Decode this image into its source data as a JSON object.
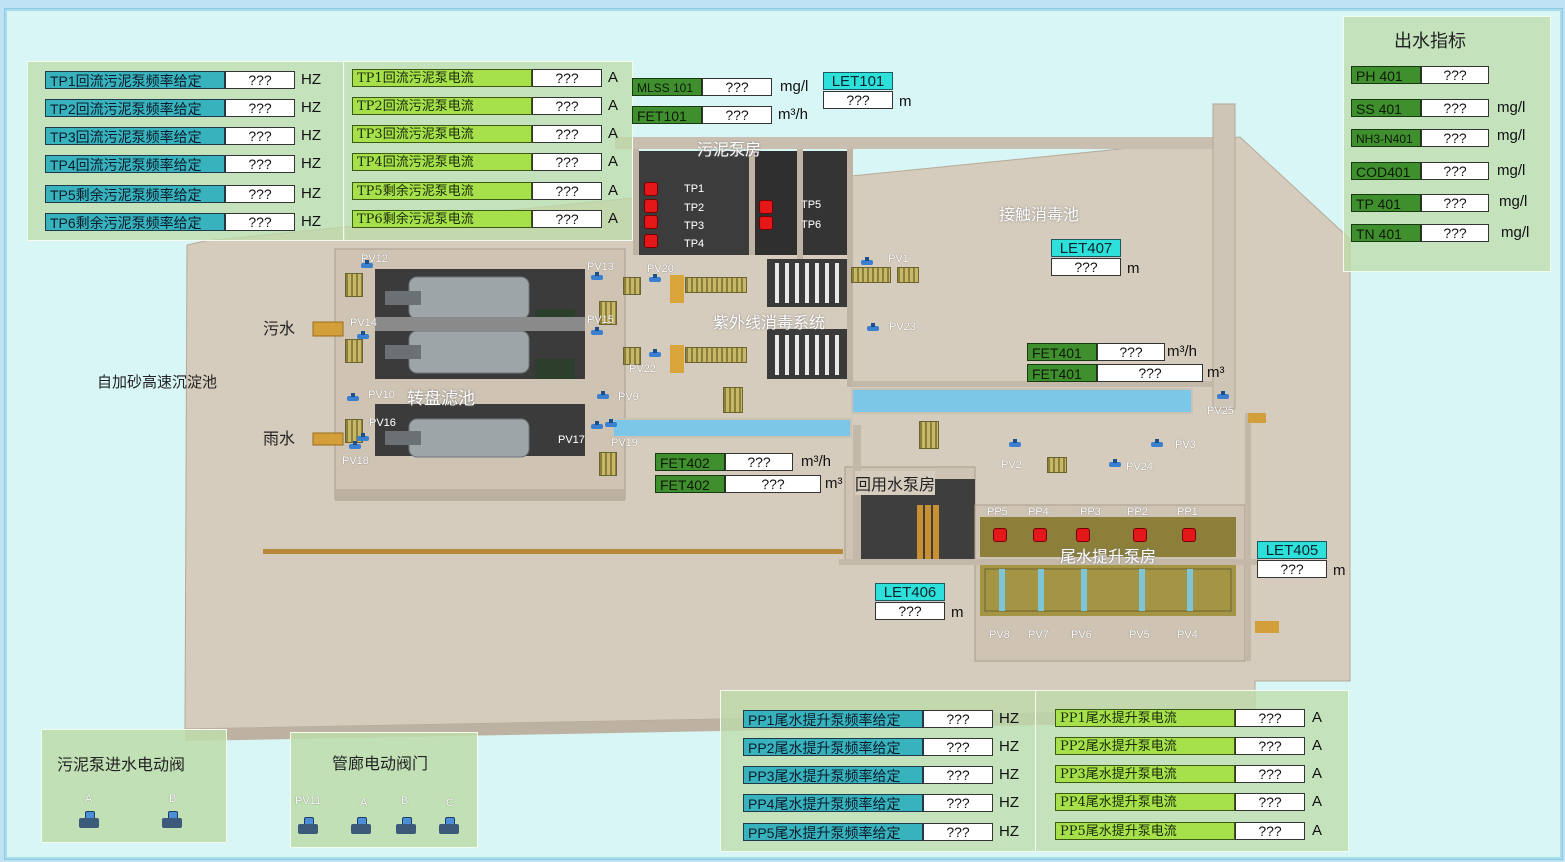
{
  "placeholder": "???",
  "areas": {
    "sedimentation": "自加砂高速沉淀池",
    "sewage": "污水",
    "rain": "雨水",
    "disc_filter": "转盘滤池",
    "sludge_pump_house": "污泥泵房",
    "uv_system": "紫外线消毒系统",
    "contact_pool": "接触消毒池",
    "reuse_pump_house": "回用水泵房",
    "tail_lift_pump_house": "尾水提升泵房"
  },
  "tp_freq_panel": {
    "unit": "HZ",
    "rows": [
      {
        "label": "TP1回流污泥泵频率给定",
        "value": "???"
      },
      {
        "label": "TP2回流污泥泵频率给定",
        "value": "???"
      },
      {
        "label": "TP3回流污泥泵频率给定",
        "value": "???"
      },
      {
        "label": "TP4回流污泥泵频率给定",
        "value": "???"
      },
      {
        "label": "TP5剩余污泥泵频率给定",
        "value": "???"
      },
      {
        "label": "TP6剩余污泥泵频率给定",
        "value": "???"
      }
    ]
  },
  "tp_current_panel": {
    "unit": "A",
    "rows": [
      {
        "label": "TP1回流污泥泵电流",
        "value": "???"
      },
      {
        "label": "TP2回流污泥泵电流",
        "value": "???"
      },
      {
        "label": "TP3回流污泥泵电流",
        "value": "???"
      },
      {
        "label": "TP4回流污泥泵电流",
        "value": "???"
      },
      {
        "label": "TP5剩余污泥泵电流",
        "value": "???"
      },
      {
        "label": "TP6剩余污泥泵电流",
        "value": "???"
      }
    ]
  },
  "instruments": {
    "mlss101": {
      "label": "MLSS 101",
      "value": "???",
      "unit": "mg/l"
    },
    "fet101": {
      "label": "FET101",
      "value": "???",
      "unit": "m³/h"
    },
    "let101": {
      "label": "LET101",
      "value": "???",
      "unit": "m"
    },
    "let407": {
      "label": "LET407",
      "value": "???",
      "unit": "m"
    },
    "fet401_flow": {
      "label": "FET401",
      "value": "???",
      "unit": "m³/h"
    },
    "fet401_total": {
      "label": "FET401",
      "value": "???",
      "unit": "m³"
    },
    "fet402_flow": {
      "label": "FET402",
      "value": "???",
      "unit": "m³/h"
    },
    "fet402_total": {
      "label": "FET402",
      "value": "???",
      "unit": "m³"
    },
    "let405": {
      "label": "LET405",
      "value": "???",
      "unit": "m"
    },
    "let406": {
      "label": "LET406",
      "value": "???",
      "unit": "m"
    }
  },
  "effluent_panel": {
    "title": "出水指标",
    "rows": [
      {
        "label": "PH 401",
        "value": "???",
        "unit": ""
      },
      {
        "label": "SS 401",
        "value": "???",
        "unit": "mg/l"
      },
      {
        "label": "NH3-N401",
        "value": "???",
        "unit": "mg/l"
      },
      {
        "label": "COD401",
        "value": "???",
        "unit": "mg/l"
      },
      {
        "label": "TP 401",
        "value": "???",
        "unit": "mg/l"
      },
      {
        "label": "TN 401",
        "value": "???",
        "unit": "mg/l"
      }
    ]
  },
  "pp_freq_panel": {
    "unit": "HZ",
    "rows": [
      {
        "label": "PP1尾水提升泵频率给定",
        "value": "???"
      },
      {
        "label": "PP2尾水提升泵频率给定",
        "value": "???"
      },
      {
        "label": "PP3尾水提升泵频率给定",
        "value": "???"
      },
      {
        "label": "PP4尾水提升泵频率给定",
        "value": "???"
      },
      {
        "label": "PP5尾水提升泵频率给定",
        "value": "???"
      }
    ]
  },
  "pp_current_panel": {
    "unit": "A",
    "rows": [
      {
        "label": "PP1尾水提升泵电流",
        "value": "???"
      },
      {
        "label": "PP2尾水提升泵电流",
        "value": "???"
      },
      {
        "label": "PP3尾水提升泵电流",
        "value": "???"
      },
      {
        "label": "PP4尾水提升泵电流",
        "value": "???"
      },
      {
        "label": "PP5尾水提升泵电流",
        "value": "???"
      }
    ]
  },
  "sludge_valves_panel": {
    "title": "污泥泵进水电动阀",
    "valves": [
      "A",
      "B"
    ]
  },
  "gallery_valves_panel": {
    "title": "管廊电动阀门",
    "valves": [
      "PV11",
      "A",
      "B",
      "C"
    ]
  },
  "tags": {
    "tp1": "TP1",
    "tp2": "TP2",
    "tp3": "TP3",
    "tp4": "TP4",
    "tp5": "TP5",
    "tp6": "TP6",
    "pv1": "PV1",
    "pv2": "PV2",
    "pv3": "PV3",
    "pv4": "PV4",
    "pv5": "PV5",
    "pv6": "PV6",
    "pv7": "PV7",
    "pv8": "PV8",
    "pv9": "PV9",
    "pv10": "PV10",
    "pv12": "PV12",
    "pv13": "PV13",
    "pv14": "PV14",
    "pv15": "PV15",
    "pv16": "PV16",
    "pv17": "PV17",
    "pv18": "PV18",
    "pv19": "PV19",
    "pv20": "PV20",
    "pv22": "PV22",
    "pv23": "PV23",
    "pv24": "PV24",
    "pv25": "PV25",
    "pp1": "PP1",
    "pp2": "PP2",
    "pp3": "PP3",
    "pp4": "PP4",
    "pp5": "PP5"
  },
  "colors": {
    "background": "#d8f6f5",
    "floor": "#d9cfc0",
    "wall": "#cabfb0",
    "teal_label": "#38b3bd",
    "lime_label": "#a6e04a",
    "green_label": "#3f8f2f",
    "cyan_label": "#2ee0da",
    "alarm_red": "#e41818",
    "water": "#7cc6e8"
  }
}
